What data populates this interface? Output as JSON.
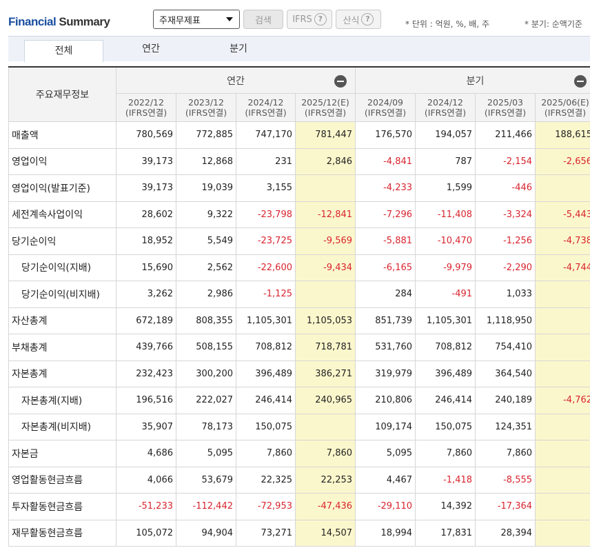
{
  "header": {
    "title_financial": "Financial",
    "title_summary": "Summary",
    "select_value": "주재무제표",
    "search_label": "검색",
    "ifrs_label": "IFRS",
    "sansik_label": "산식",
    "help_glyph": "?",
    "unit_note": "* 단위 : 억원, %, 배, 주",
    "quarter_note": "* 분기: 순액기준"
  },
  "tabs": [
    "전체",
    "연간",
    "분기"
  ],
  "table": {
    "corner_label": "주요재무정보",
    "group_annual": "연간",
    "group_quarter": "분기",
    "columns": [
      {
        "period": "2022/12",
        "sub": "(IFRS연결)"
      },
      {
        "period": "2023/12",
        "sub": "(IFRS연결)"
      },
      {
        "period": "2024/12",
        "sub": "(IFRS연결)"
      },
      {
        "period": "2025/12(E)",
        "sub": "(IFRS연결)"
      },
      {
        "period": "2024/09",
        "sub": "(IFRS연결)"
      },
      {
        "period": "2024/12",
        "sub": "(IFRS연결)"
      },
      {
        "period": "2025/03",
        "sub": "(IFRS연결)"
      },
      {
        "period": "2025/06(E)",
        "sub": "(IFRS연결)"
      }
    ],
    "rows": [
      {
        "label": "매출액",
        "values": [
          "780,569",
          "772,885",
          "747,170",
          "781,447",
          "176,570",
          "194,057",
          "211,466",
          "188,615"
        ]
      },
      {
        "label": "영업이익",
        "values": [
          "39,173",
          "12,868",
          "231",
          "2,846",
          "-4,841",
          "787",
          "-2,154",
          "-2,656"
        ]
      },
      {
        "label": "영업이익(발표기준)",
        "values": [
          "39,173",
          "19,039",
          "3,155",
          "",
          "-4,233",
          "1,599",
          "-446",
          ""
        ]
      },
      {
        "label": "세전계속사업이익",
        "values": [
          "28,602",
          "9,322",
          "-23,798",
          "-12,841",
          "-7,296",
          "-11,408",
          "-3,324",
          "-5,443"
        ]
      },
      {
        "label": "당기순이익",
        "values": [
          "18,952",
          "5,549",
          "-23,725",
          "-9,569",
          "-5,881",
          "-10,470",
          "-1,256",
          "-4,738"
        ]
      },
      {
        "label": "당기순이익(지배)",
        "values": [
          "15,690",
          "2,562",
          "-22,600",
          "-9,434",
          "-6,165",
          "-9,979",
          "-2,290",
          "-4,744"
        ]
      },
      {
        "label": "당기순이익(비지배)",
        "values": [
          "3,262",
          "2,986",
          "-1,125",
          "",
          "284",
          "-491",
          "1,033",
          ""
        ]
      },
      {
        "label": "자산총계",
        "values": [
          "672,189",
          "808,355",
          "1,105,301",
          "1,105,053",
          "851,739",
          "1,105,301",
          "1,118,950",
          ""
        ]
      },
      {
        "label": "부채총계",
        "values": [
          "439,766",
          "508,155",
          "708,812",
          "718,781",
          "531,760",
          "708,812",
          "754,410",
          ""
        ]
      },
      {
        "label": "자본총계",
        "values": [
          "232,423",
          "300,200",
          "396,489",
          "386,271",
          "319,979",
          "396,489",
          "364,540",
          ""
        ]
      },
      {
        "label": "자본총계(지배)",
        "values": [
          "196,516",
          "222,027",
          "246,414",
          "240,965",
          "210,806",
          "246,414",
          "240,189",
          "-4,762"
        ]
      },
      {
        "label": "자본총계(비지배)",
        "values": [
          "35,907",
          "78,173",
          "150,075",
          "",
          "109,174",
          "150,075",
          "124,351",
          ""
        ]
      },
      {
        "label": "자본금",
        "values": [
          "4,686",
          "5,095",
          "7,860",
          "7,860",
          "5,095",
          "7,860",
          "7,860",
          ""
        ]
      },
      {
        "label": "영업활동현금흐름",
        "values": [
          "4,066",
          "53,679",
          "22,325",
          "22,253",
          "4,467",
          "-1,418",
          "-8,555",
          ""
        ]
      },
      {
        "label": "투자활동현금흐름",
        "values": [
          "-51,233",
          "-112,442",
          "-72,953",
          "-47,436",
          "-29,110",
          "14,392",
          "-17,364",
          ""
        ]
      },
      {
        "label": "재무활동현금흐름",
        "values": [
          "105,072",
          "94,904",
          "73,271",
          "14,507",
          "18,994",
          "17,831",
          "28,394",
          ""
        ]
      }
    ]
  }
}
